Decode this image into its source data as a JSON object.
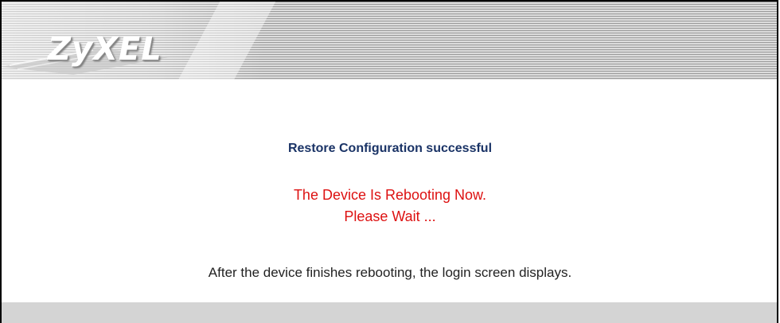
{
  "header": {
    "logo_text": "ZyXEL"
  },
  "message": {
    "success": "Restore Configuration successful",
    "rebooting_line1": "The Device Is Rebooting Now.",
    "rebooting_line2": "Please Wait ...",
    "info": "After the device finishes rebooting, the login screen displays."
  },
  "colors": {
    "success_text": "#1a3366",
    "warning_text": "#dd1111",
    "footer_bar": "#d4d4d4"
  }
}
